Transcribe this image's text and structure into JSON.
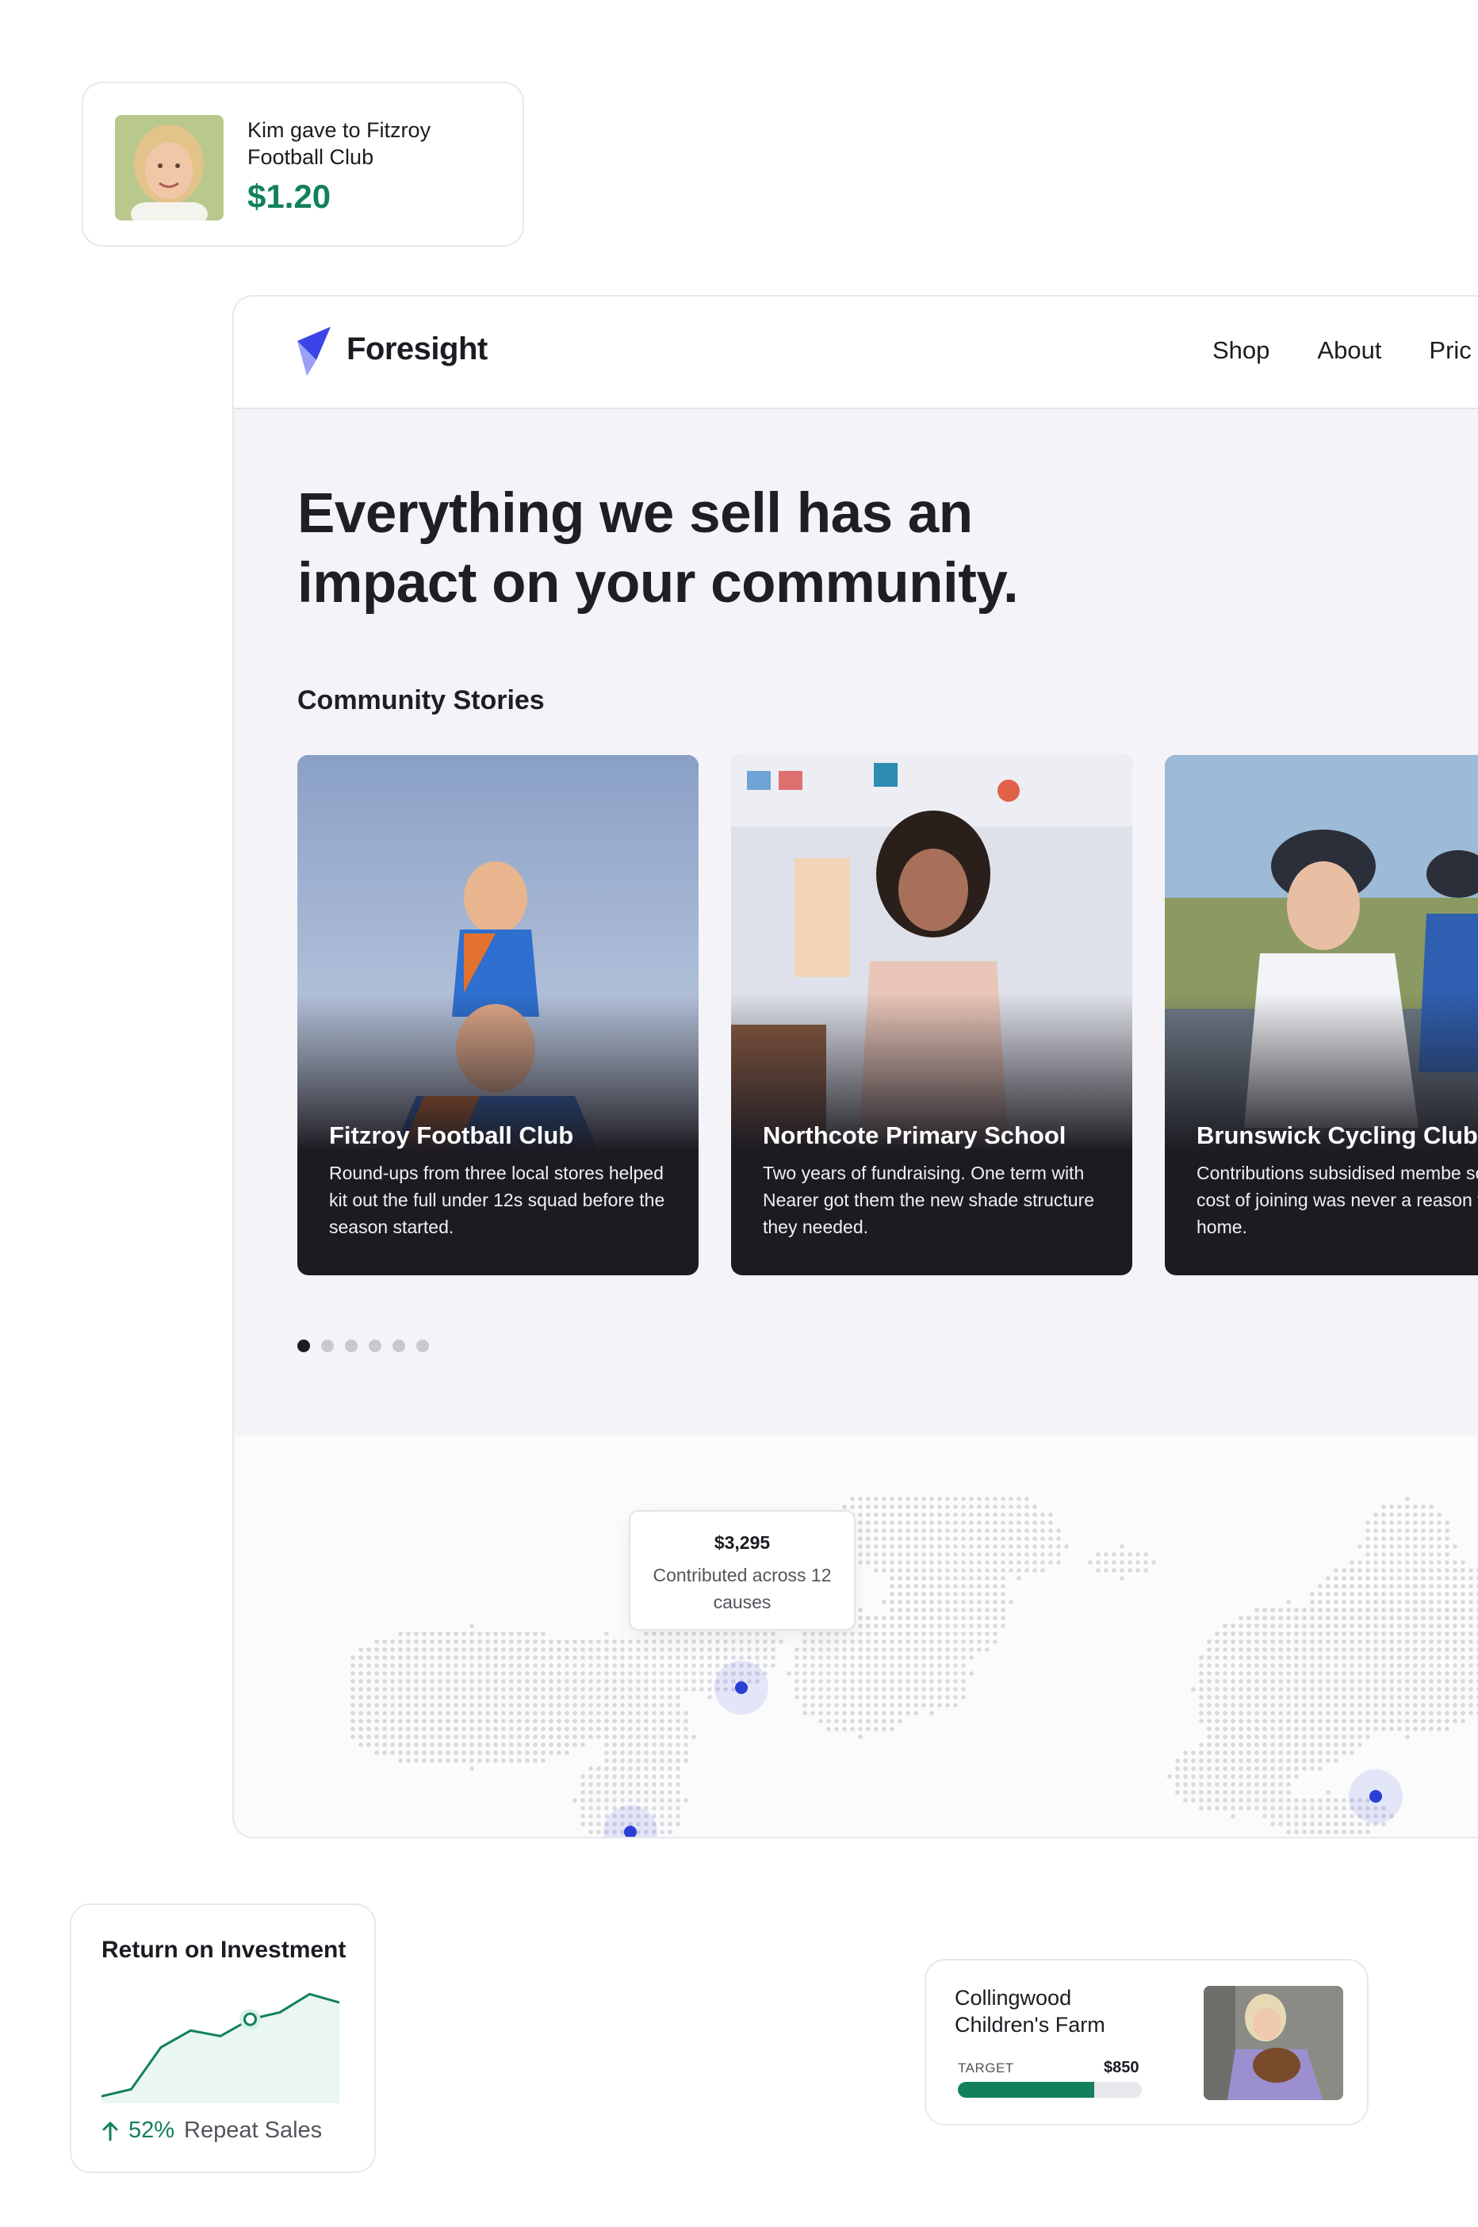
{
  "donation_card": {
    "text": "Kim gave to Fitzroy Football Club",
    "amount": "$1.20"
  },
  "site": {
    "brand": "Foresight",
    "nav": [
      "Shop",
      "About",
      "Pric"
    ],
    "hero_title": "Everything we sell has an impact on your community.",
    "stories_heading": "Community Stories",
    "stories": [
      {
        "title": "Fitzroy Football Club",
        "body": "Round-ups from three local stores helped kit out the full under 12s squad before the season started."
      },
      {
        "title": "Northcote Primary School",
        "body": "Two years of fundraising. One term with Nearer got them the new shade structure they needed."
      },
      {
        "title": "Brunswick Cycling Club",
        "body": "Contributions subsidised membe so the cost of joining was never a reason to stay home."
      }
    ],
    "carousel": {
      "pages": 6,
      "active": 0
    },
    "map_tooltip": {
      "amount": "$3,295",
      "caption": "Contributed across 12 causes"
    }
  },
  "roi_card": {
    "title": "Return on Investment",
    "percent": "52%",
    "label": "Repeat Sales",
    "trend": [
      5,
      10,
      40,
      52,
      48,
      60,
      65,
      78,
      72
    ]
  },
  "farm_card": {
    "name": "Collingwood Children's Farm",
    "target_label": "TARGET",
    "target_value": "$850",
    "progress": 0.74
  },
  "colors": {
    "accent_green": "#12805c",
    "brand_blue": "#3b44e6",
    "map_marker": "#2b3fd6"
  }
}
